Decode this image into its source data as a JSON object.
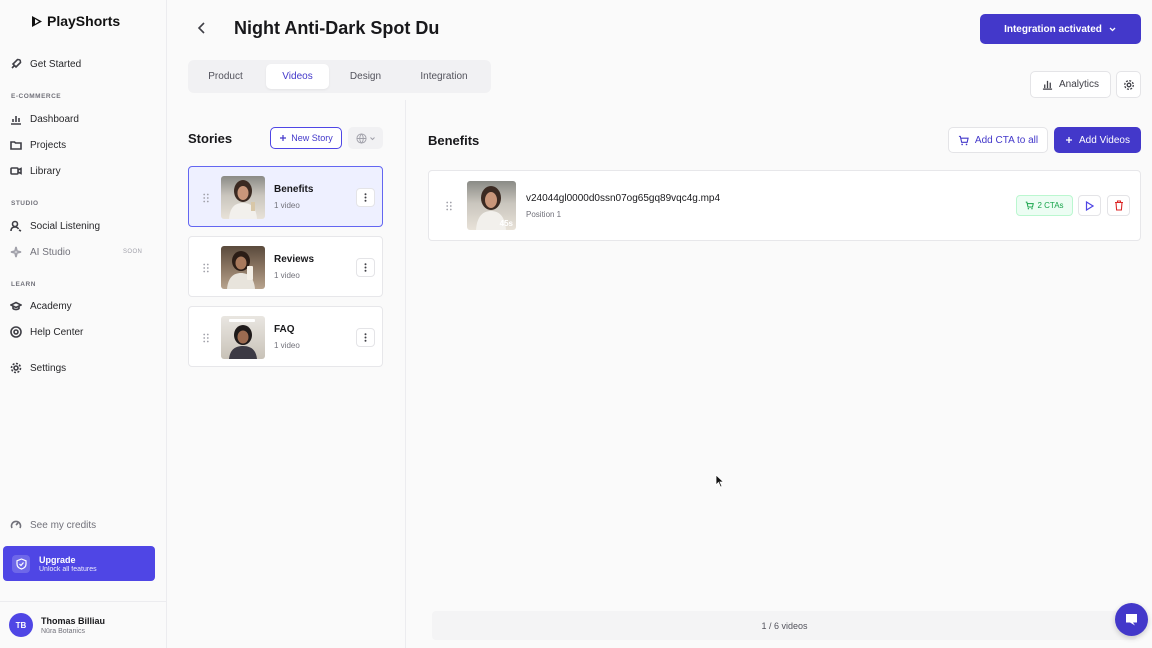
{
  "app": {
    "name": "PlayShorts"
  },
  "sidebar": {
    "get_started": "Get Started",
    "sections": {
      "ecommerce": "E-COMMERCE",
      "studio": "STUDIO",
      "learn": "LEARN"
    },
    "items": {
      "dashboard": "Dashboard",
      "projects": "Projects",
      "library": "Library",
      "social_listening": "Social Listening",
      "ai_studio": "AI Studio",
      "academy": "Academy",
      "help_center": "Help Center",
      "settings": "Settings"
    },
    "soon_badge": "SOON",
    "credits": "See my credits",
    "upgrade": {
      "title": "Upgrade",
      "subtitle": "Unlock all features"
    },
    "user": {
      "initials": "TB",
      "name": "Thomas Billiau",
      "org": "Nūra Botanics"
    }
  },
  "header": {
    "title": "Night Anti-Dark Spot Du",
    "integration_button": "Integration activated",
    "tabs": [
      "Product",
      "Videos",
      "Design",
      "Integration"
    ],
    "active_tab": "Videos",
    "analytics": "Analytics"
  },
  "stories": {
    "title": "Stories",
    "new_story": "New Story",
    "items": [
      {
        "name": "Benefits",
        "count": "1 video",
        "selected": true
      },
      {
        "name": "Reviews",
        "count": "1 video",
        "selected": false
      },
      {
        "name": "FAQ",
        "count": "1 video",
        "selected": false
      }
    ]
  },
  "panel": {
    "title": "Benefits",
    "add_cta": "Add CTA to all",
    "add_videos": "Add Videos",
    "videos": [
      {
        "filename": "v24044gl0000d0ssn07og65gq89vqc4g.mp4",
        "position": "Position 1",
        "duration": "45s",
        "ctas": "2 CTAs"
      }
    ],
    "footer": "1 / 6 videos"
  },
  "colors": {
    "accent": "#4338ca",
    "selected_bg": "#eef0ff",
    "cta_green": "#16a34a"
  }
}
